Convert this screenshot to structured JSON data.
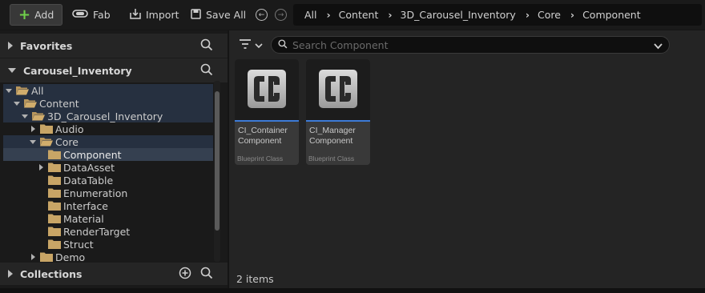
{
  "toolbar": {
    "add_label": "Add",
    "fab_label": "Fab",
    "import_label": "Import",
    "save_all_label": "Save All"
  },
  "breadcrumb": [
    "All",
    "Content",
    "3D_Carousel_Inventory",
    "Core",
    "Component"
  ],
  "sidebar": {
    "favorites_label": "Favorites",
    "project_label": "Carousel_Inventory",
    "collections_label": "Collections",
    "tree": [
      {
        "label": "All",
        "depth": 0,
        "expanded": true
      },
      {
        "label": "Content",
        "depth": 1,
        "expanded": true
      },
      {
        "label": "3D_Carousel_Inventory",
        "depth": 2,
        "expanded": true
      },
      {
        "label": "Audio",
        "depth": 3,
        "expanded": false
      },
      {
        "label": "Core",
        "depth": 3,
        "expanded": true
      },
      {
        "label": "Component",
        "depth": 4,
        "selected": true
      },
      {
        "label": "DataAsset",
        "depth": 4,
        "expanded": false
      },
      {
        "label": "DataTable",
        "depth": 4
      },
      {
        "label": "Enumeration",
        "depth": 4
      },
      {
        "label": "Interface",
        "depth": 4
      },
      {
        "label": "Material",
        "depth": 4
      },
      {
        "label": "RenderTarget",
        "depth": 4
      },
      {
        "label": "Struct",
        "depth": 4
      },
      {
        "label": "Demo",
        "depth": 3,
        "expanded": false
      }
    ]
  },
  "search": {
    "placeholder": "Search Component"
  },
  "assets": [
    {
      "name": "CI_Container Component",
      "type": "Blueprint Class"
    },
    {
      "name": "CI_Manager Component",
      "type": "Blueprint Class"
    }
  ],
  "status": {
    "items_count": "2 items"
  },
  "colors": {
    "accent": "#3d7ad6",
    "add_plus": "#6fd04a",
    "folder": "#c8a566",
    "selection": "#354050"
  }
}
